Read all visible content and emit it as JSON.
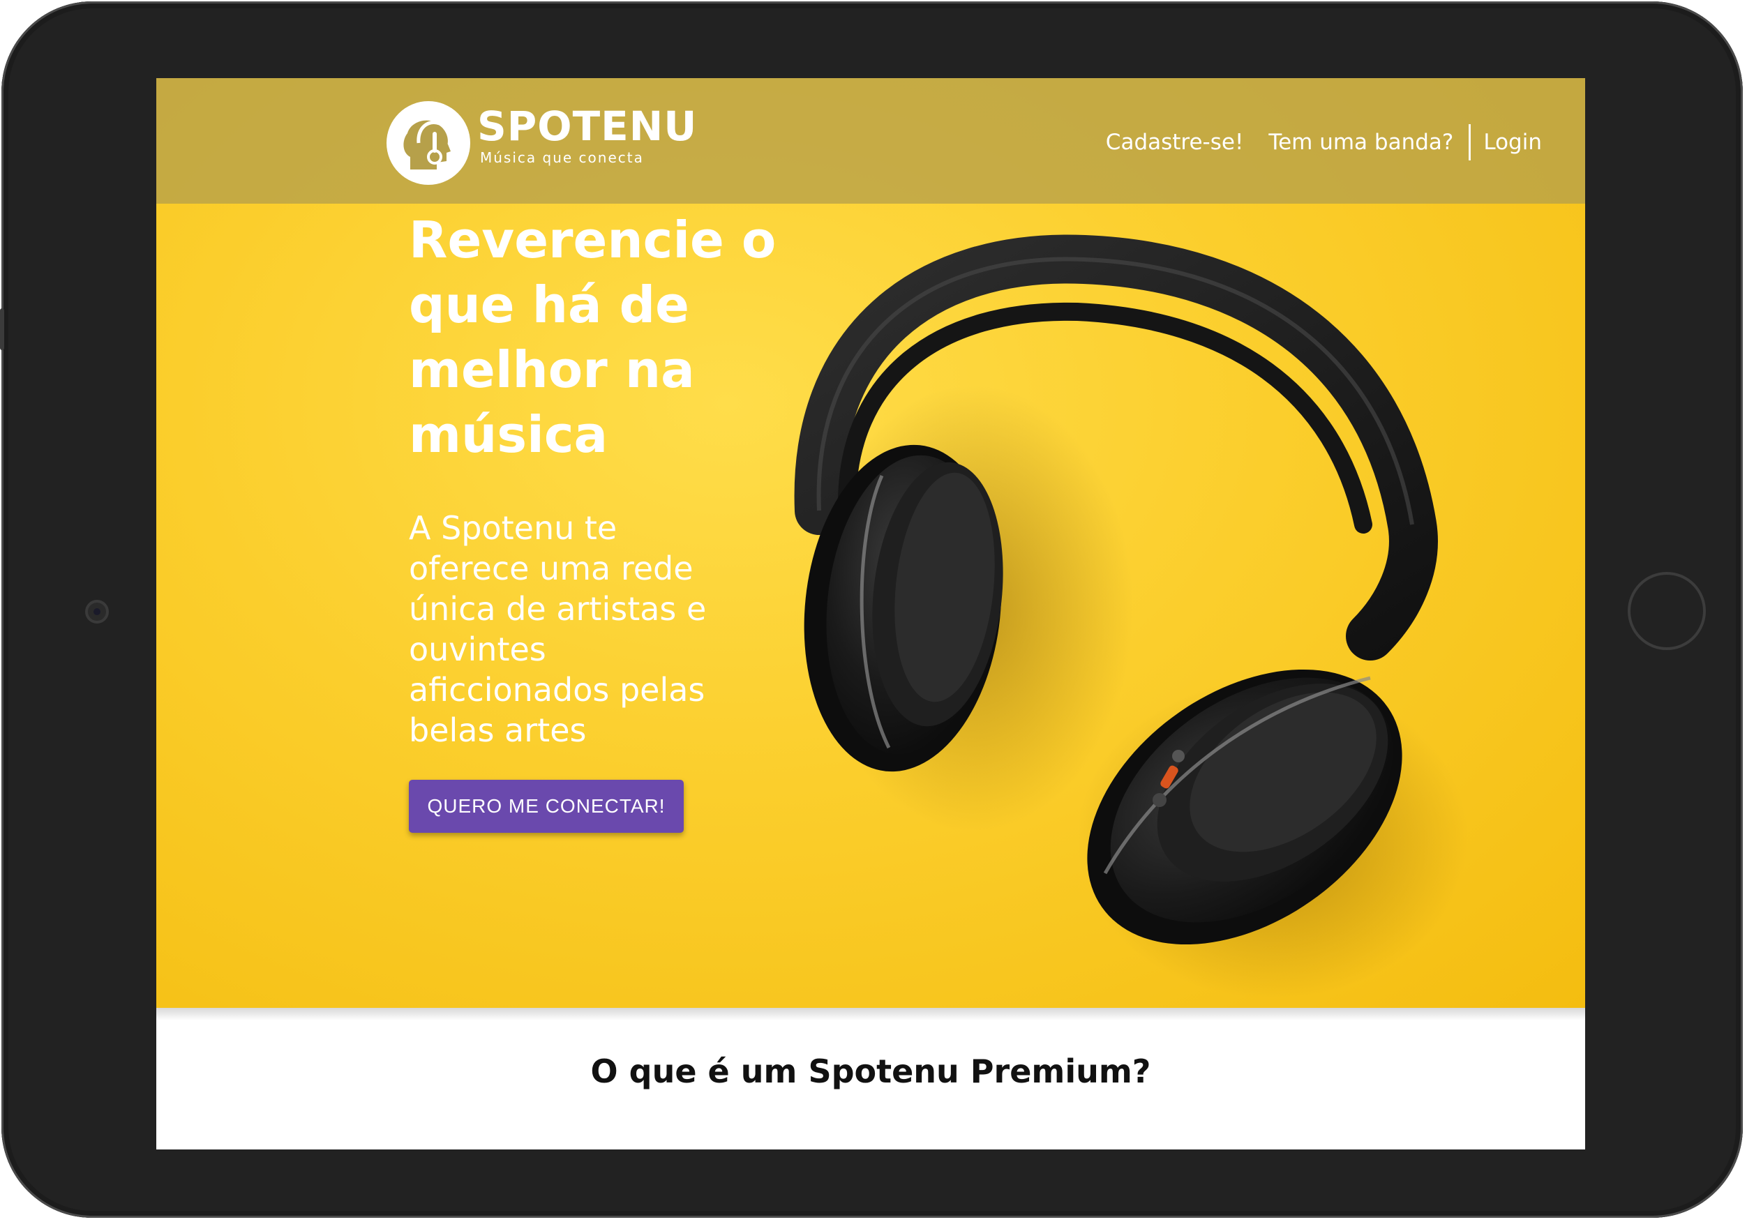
{
  "brand": {
    "name": "SPOTENU",
    "tagline": "Música que conecta"
  },
  "nav": {
    "signup": "Cadastre-se!",
    "band": "Tem uma banda?",
    "login": "Login"
  },
  "hero": {
    "headline": "Reverencie o que há de melhor na música",
    "subtext": "A Spotenu te oferece uma rede única de artistas e ouvintes aficcionados pelas belas artes",
    "cta_label": "QUERO ME CONECTAR!"
  },
  "section": {
    "title": "O que é um Spotenu Premium?"
  },
  "colors": {
    "hero_yellow": "#fbce2c",
    "header_overlay": "#b6a04a",
    "cta_purple": "#6a49ad",
    "device_frame": "#222222"
  },
  "icons": {
    "logo": "head-with-headphones-icon",
    "hero_image": "headphones-photo"
  }
}
